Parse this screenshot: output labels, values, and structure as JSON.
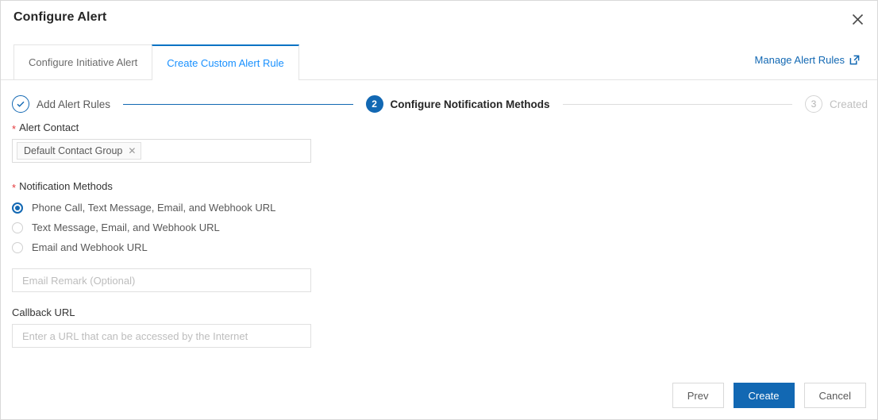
{
  "dialog": {
    "title": "Configure Alert",
    "close_icon": "close-icon"
  },
  "tabs": [
    {
      "label": "Configure Initiative Alert",
      "active": false
    },
    {
      "label": "Create Custom Alert Rule",
      "active": true
    }
  ],
  "manage_link": {
    "label": "Manage Alert Rules",
    "icon": "external-link-icon"
  },
  "steps": [
    {
      "number": "",
      "label": "Add Alert Rules",
      "state": "done",
      "icon": "check-icon"
    },
    {
      "number": "2",
      "label": "Configure Notification Methods",
      "state": "current"
    },
    {
      "number": "3",
      "label": "Created",
      "state": "pending"
    }
  ],
  "form": {
    "alert_contact": {
      "label": "Alert Contact",
      "required": true,
      "required_marker": "*",
      "tags": [
        {
          "label": "Default Contact Group",
          "close_icon": "tag-close-icon",
          "close_glyph": "✕"
        }
      ]
    },
    "notification_methods": {
      "label": "Notification Methods",
      "required": true,
      "required_marker": "*",
      "options": [
        {
          "label": "Phone Call, Text Message, Email, and Webhook URL",
          "selected": true
        },
        {
          "label": "Text Message, Email, and Webhook URL",
          "selected": false
        },
        {
          "label": "Email and Webhook URL",
          "selected": false
        }
      ]
    },
    "email_remark": {
      "value": "",
      "placeholder": "Email Remark (Optional)"
    },
    "callback_url": {
      "label": "Callback URL",
      "value": "",
      "placeholder": "Enter a URL that can be accessed by the Internet"
    }
  },
  "footer": {
    "prev_label": "Prev",
    "create_label": "Create",
    "cancel_label": "Cancel"
  },
  "colors": {
    "accent": "#1268b3",
    "link": "#1268b3",
    "tab_active_text": "#1890ff",
    "required": "#e4393c",
    "border": "#e0e0e0"
  }
}
